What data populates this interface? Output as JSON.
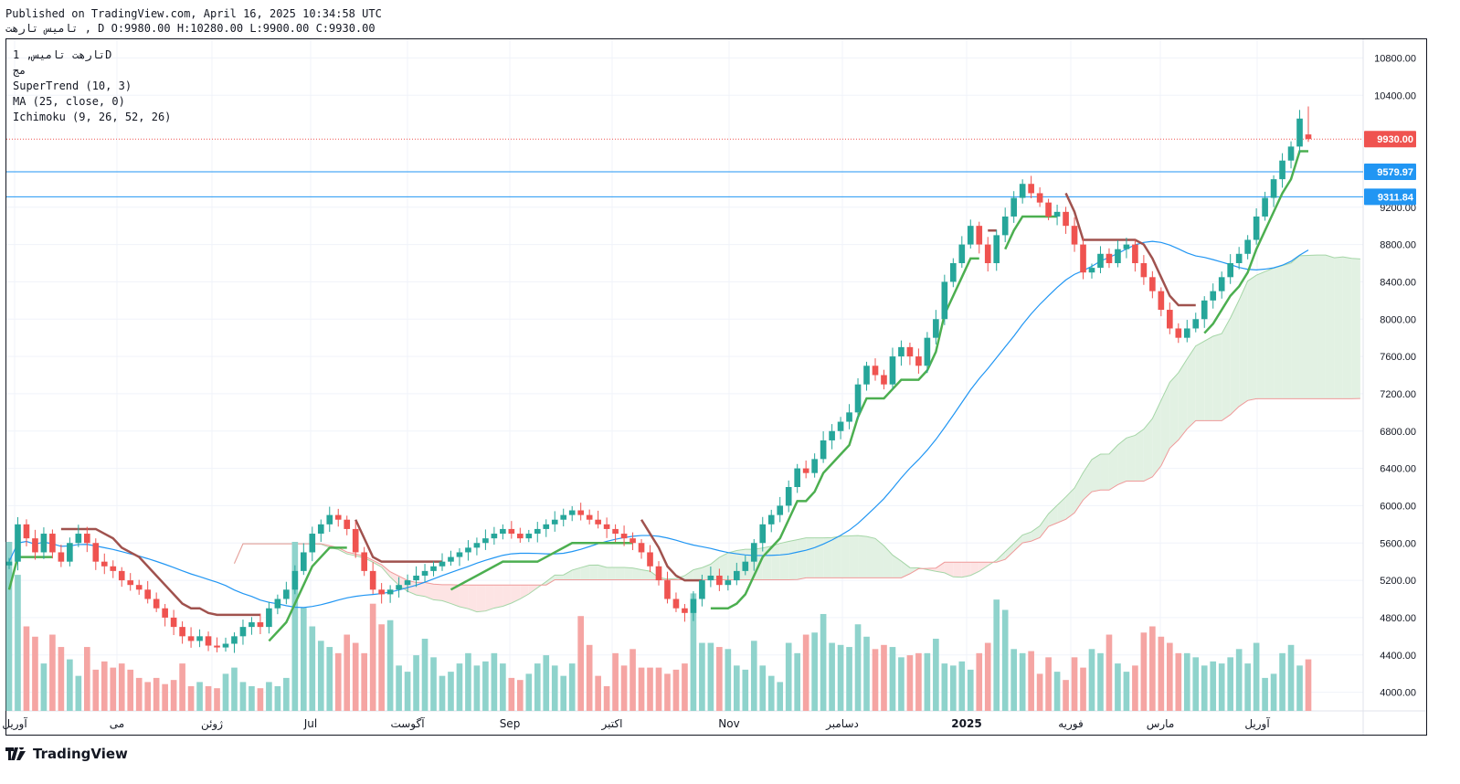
{
  "header": {
    "published": "Published on TradingView.com, April 16, 2025 10:34:58 UTC",
    "ohlc_line": "تامیس تارهت , D O:9980.00 H:10280.00 L:9900.00 C:9930.00"
  },
  "legend": {
    "symbol": "تارهت تامیس, 1D",
    "exchange": "مج",
    "indicators": [
      "SuperTrend (10, 3)",
      "MA (25, close, 0)",
      "Ichimoku (9, 26, 52, 26)"
    ]
  },
  "footer": {
    "brand": "TradingView",
    "logo_icon": "tradingview-logo-icon"
  },
  "colors": {
    "up": "#26a69a",
    "down": "#ef5350",
    "supertrend_up": "#4caf50",
    "supertrend_down": "#a0524e",
    "ma": "#2196f3",
    "hline": "#2196f3",
    "price_line": "#ef5350",
    "cloud_bull": "#e2f1e3",
    "cloud_bear": "#fde4e4"
  },
  "chart_data": {
    "type": "candlestick",
    "ylim": [
      3800,
      11000
    ],
    "y_ticks": [
      4000,
      4400,
      4800,
      5200,
      5600,
      6000,
      6400,
      6800,
      7200,
      7600,
      8000,
      8400,
      8800,
      9200,
      10400,
      10800
    ],
    "x_labels": [
      "آوریل",
      "می",
      "ژوئن",
      "Jul",
      "آگوست",
      "Sep",
      "اکتبر",
      "Nov",
      "دسامبر",
      "2025",
      "فوریه",
      "مارس",
      "آوریل"
    ],
    "horizontal_lines": [
      9579.97,
      9311.84
    ],
    "last_price": 9930.0,
    "price_labels": [
      "9930.00",
      "9579.97",
      "9311.84"
    ],
    "last_ohlc": {
      "open": 9980.0,
      "high": 10280.0,
      "low": 9900.0,
      "close": 9930.0
    },
    "closes": [
      5400,
      5800,
      5650,
      5500,
      5700,
      5500,
      5400,
      5600,
      5700,
      5600,
      5400,
      5350,
      5300,
      5200,
      5150,
      5100,
      5000,
      4900,
      4800,
      4700,
      4600,
      4550,
      4600,
      4500,
      4480,
      4520,
      4600,
      4700,
      4750,
      4700,
      4900,
      5000,
      5100,
      5300,
      5500,
      5700,
      5800,
      5900,
      5850,
      5750,
      5500,
      5300,
      5100,
      5050,
      5100,
      5150,
      5200,
      5250,
      5300,
      5350,
      5400,
      5450,
      5500,
      5550,
      5600,
      5650,
      5700,
      5750,
      5700,
      5650,
      5700,
      5750,
      5800,
      5850,
      5900,
      5950,
      5900,
      5850,
      5800,
      5750,
      5700,
      5650,
      5600,
      5500,
      5350,
      5200,
      5000,
      4900,
      4850,
      5000,
      5200,
      5250,
      5150,
      5200,
      5300,
      5400,
      5600,
      5800,
      5900,
      6000,
      6200,
      6400,
      6350,
      6500,
      6700,
      6800,
      6900,
      7000,
      7300,
      7500,
      7400,
      7300,
      7600,
      7700,
      7600,
      7500,
      7800,
      8000,
      8400,
      8600,
      8800,
      9000,
      8800,
      8600,
      8900,
      9100,
      9300,
      9450,
      9350,
      9250,
      9100,
      9150,
      9000,
      8800,
      8500,
      8550,
      8700,
      8600,
      8750,
      8800,
      8600,
      8450,
      8300,
      8100,
      7900,
      7800,
      7900,
      8000,
      8200,
      8300,
      8450,
      8600,
      8700,
      8850,
      9100,
      9300,
      9500,
      9700,
      9850,
      10150,
      9930
    ],
    "volumes": [
      820,
      660,
      410,
      360,
      230,
      370,
      310,
      250,
      170,
      310,
      200,
      240,
      210,
      230,
      200,
      160,
      140,
      160,
      130,
      150,
      230,
      120,
      140,
      120,
      110,
      180,
      210,
      140,
      120,
      110,
      140,
      120,
      160,
      820,
      500,
      410,
      340,
      310,
      280,
      370,
      330,
      280,
      520,
      420,
      440,
      220,
      190,
      270,
      350,
      260,
      170,
      190,
      230,
      280,
      220,
      240,
      280,
      230,
      160,
      150,
      180,
      230,
      270,
      220,
      170,
      230,
      460,
      320,
      170,
      120,
      280,
      220,
      300,
      210,
      210,
      210,
      180,
      200,
      230,
      570,
      330,
      330,
      310,
      300,
      220,
      200,
      340,
      220,
      170,
      140,
      330,
      280,
      370,
      380,
      470,
      330,
      320,
      310,
      420,
      360,
      300,
      320,
      310,
      260,
      270,
      280,
      280,
      350,
      230,
      220,
      240,
      200,
      280,
      330,
      540,
      490,
      300,
      280,
      290,
      180,
      260,
      190,
      150,
      260,
      210,
      300,
      280,
      370,
      230,
      190,
      220,
      380,
      410,
      360,
      330,
      280,
      280,
      260,
      220,
      240,
      230,
      260,
      300,
      230,
      330,
      160,
      180,
      280,
      320,
      220,
      250,
      380,
      300,
      300
    ],
    "supertrend": [],
    "ma25": [],
    "ichimoku": {}
  }
}
